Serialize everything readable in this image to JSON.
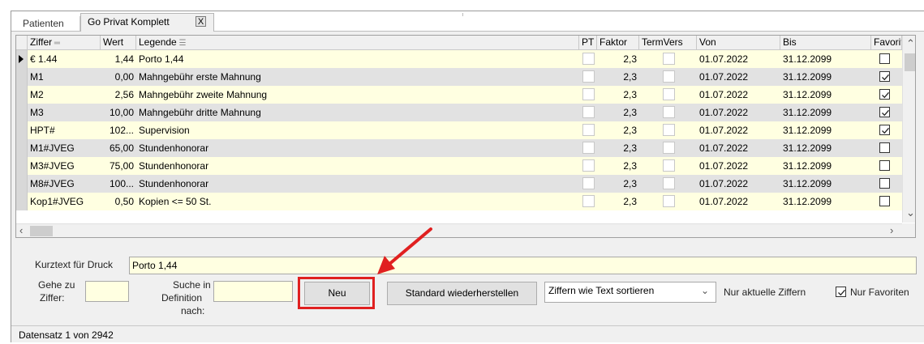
{
  "tabs": [
    {
      "label": "Patienten"
    },
    {
      "label": "Go Privat Komplett",
      "close": "X"
    }
  ],
  "grid": {
    "columns": [
      "Ziffer",
      "Wert",
      "Legende",
      "PT",
      "Faktor",
      "TermVers",
      "Von",
      "Bis",
      "Favorit"
    ],
    "rows": [
      {
        "ziffer": "€ 1.44",
        "wert": "1,44",
        "legende": "Porto 1,44",
        "faktor": "2,3",
        "von": "01.07.2022",
        "bis": "31.12.2099",
        "favorit": false
      },
      {
        "ziffer": "M1",
        "wert": "0,00",
        "legende": "Mahngebühr erste Mahnung",
        "faktor": "2,3",
        "von": "01.07.2022",
        "bis": "31.12.2099",
        "favorit": true
      },
      {
        "ziffer": "M2",
        "wert": "2,56",
        "legende": "Mahngebühr zweite Mahnung",
        "faktor": "2,3",
        "von": "01.07.2022",
        "bis": "31.12.2099",
        "favorit": true
      },
      {
        "ziffer": "M3",
        "wert": "10,00",
        "legende": "Mahngebühr dritte Mahnung",
        "faktor": "2,3",
        "von": "01.07.2022",
        "bis": "31.12.2099",
        "favorit": true
      },
      {
        "ziffer": "HPT#",
        "wert": "102...",
        "legende": "Supervision",
        "faktor": "2,3",
        "von": "01.07.2022",
        "bis": "31.12.2099",
        "favorit": true
      },
      {
        "ziffer": "M1#JVEG",
        "wert": "65,00",
        "legende": "Stundenhonorar",
        "faktor": "2,3",
        "von": "01.07.2022",
        "bis": "31.12.2099",
        "favorit": false
      },
      {
        "ziffer": "M3#JVEG",
        "wert": "75,00",
        "legende": "Stundenhonorar",
        "faktor": "2,3",
        "von": "01.07.2022",
        "bis": "31.12.2099",
        "favorit": false
      },
      {
        "ziffer": "M8#JVEG",
        "wert": "100...",
        "legende": "Stundenhonorar",
        "faktor": "2,3",
        "von": "01.07.2022",
        "bis": "31.12.2099",
        "favorit": false
      },
      {
        "ziffer": "Kop1#JVEG",
        "wert": "0,50",
        "legende": "Kopien <= 50 St.",
        "faktor": "2,3",
        "von": "01.07.2022",
        "bis": "31.12.2099",
        "favorit": false
      }
    ]
  },
  "form": {
    "kurztext_label": "Kurztext für Druck",
    "kurztext_value": "Porto 1,44",
    "gehe_zu_label_1": "Gehe zu",
    "gehe_zu_label_2": "Ziffer:",
    "gehe_zu_value": "",
    "suche_label_1": "Suche in",
    "suche_label_2": "Definition",
    "suche_label_3": "nach:",
    "suche_value": "",
    "neu_button": "Neu",
    "standard_button": "Standard wiederherstellen",
    "sort_select": "Ziffern wie Text sortieren",
    "nur_aktuelle_label": "Nur aktuelle Ziffern",
    "nur_favoriten_label": "Nur Favoriten",
    "nur_favoriten_checked": true
  },
  "status": "Datensatz 1 von 2942",
  "colors": {
    "row_odd": "#ffffe1",
    "row_even": "#e2e2e2",
    "highlight": "#e02020"
  }
}
